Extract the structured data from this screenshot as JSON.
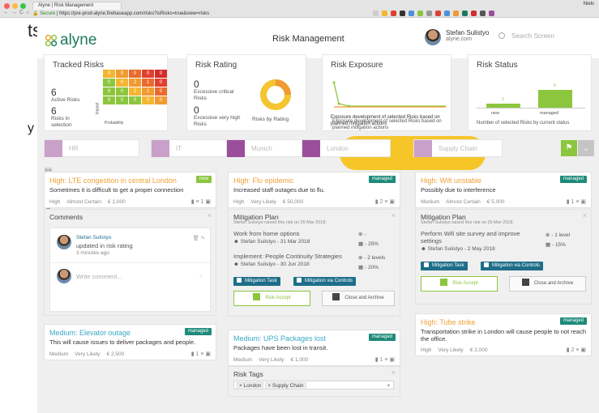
{
  "browser": {
    "tab_title": "Alyne | Risk Management",
    "secure_label": "Secure",
    "url": "https://pre-prod-alyne.firebaseapp.com/risks?isRisks=true&view=risks",
    "profile": "Niels"
  },
  "header": {
    "logo_text": "alyne",
    "page_title": "Risk Management",
    "user_name": "Stefan Sulistyo",
    "user_org": "alyne.com",
    "search_placeholder": "Search Screen"
  },
  "panels": {
    "tracked": {
      "title": "Tracked Risks",
      "active_count": "6",
      "active_label": "Active Risks",
      "selection_count": "6",
      "selection_label": "Risks in selection",
      "impact_label": "Impact",
      "probability_label": "Probability",
      "grid": [
        [
          "0",
          "0",
          "0",
          "0",
          "0"
        ],
        [
          "0",
          "0",
          "2",
          "1",
          "0"
        ],
        [
          "0",
          "0",
          "2",
          "1",
          "0"
        ],
        [
          "0",
          "0",
          "0",
          "0",
          "0"
        ]
      ],
      "grid_colors": [
        [
          "#f4b531",
          "#f09a31",
          "#ea6a2c",
          "#e0402e",
          "#d42b2b"
        ],
        [
          "#8cc63f",
          "#f4b531",
          "#f09a31",
          "#ea6a2c",
          "#e0402e"
        ],
        [
          "#8cc63f",
          "#8cc63f",
          "#f4b531",
          "#f09a31",
          "#ea6a2c"
        ],
        [
          "#8cc63f",
          "#8cc63f",
          "#8cc63f",
          "#f4b531",
          "#f09a31"
        ]
      ]
    },
    "rating": {
      "title": "Risk Rating",
      "excessive_critical_count": "0",
      "excessive_critical_label": "Excessive critical Risks",
      "excessive_high_count": "0",
      "excessive_high_label": "Excessive very high Risks",
      "by_rating_label": "Risks by Rating"
    },
    "exposure": {
      "title": "Risk Exposure",
      "caption": "Exposure development of selected Risks based on planned mitigation actions"
    },
    "status": {
      "title": "Risk Status",
      "bars": [
        {
          "label": "new",
          "value": 1
        },
        {
          "label": "managed",
          "value": 5
        }
      ],
      "caption": "Number of selected Risks by current status"
    }
  },
  "filters": [
    {
      "label": "HR",
      "color": "#c9a0c9"
    },
    {
      "label": "IT",
      "color": "#c9a0c9"
    },
    {
      "label": "Munich",
      "color": "#9b4f9b"
    },
    {
      "label": "London",
      "color": "#9b4f9b"
    },
    {
      "label": "Supply Chain",
      "color": "#c9a0c9"
    }
  ],
  "cards": {
    "lte": {
      "title": "High: LTE congestion in central London",
      "badge": "new",
      "desc": "Sometimes it is difficult to get a proper connection",
      "level": "High",
      "prob": "Almost Certain",
      "cost": "€ 1,000",
      "count": "1"
    },
    "flu": {
      "title": "High: Flu epidemic",
      "badge": "managed",
      "desc": "Increased staff outages due to flu.",
      "level": "High",
      "prob": "Very Likely",
      "cost": "€ 50,000",
      "count": "2"
    },
    "wifi": {
      "title": "High: Wifi unstable",
      "badge": "managed",
      "desc": "Possibly due to interference",
      "level": "Medium",
      "prob": "Almost Certain",
      "cost": "€ 5,000",
      "count": "1"
    },
    "elevator": {
      "title": "Medium: Elevator outage",
      "badge": "managed",
      "desc": "This will cause issues to deliver packages and people.",
      "level": "Medium",
      "prob": "Very Likely",
      "cost": "€ 2,500",
      "count": "1"
    },
    "ups": {
      "title": "Medium: UPS Packages lost",
      "badge": "managed",
      "desc": "Packages have been lost in transit.",
      "level": "Medium",
      "prob": "Very Likely",
      "cost": "€ 1,000",
      "count": "1"
    },
    "tube": {
      "title": "High: Tube strike",
      "badge": "managed",
      "desc": "Transportation strike in London will cause people to not reach the office.",
      "level": "High",
      "prob": "Very Likely",
      "cost": "€ 2,000",
      "count": "2"
    }
  },
  "comments": {
    "title": "Comments",
    "author": "Stefan Sulistyo",
    "text": "updated in risk rating",
    "time": "3 minutes ago",
    "placeholder": "Write comment..."
  },
  "mitigation_flu": {
    "title": "Mitigation Plan",
    "note": "Stefan Sulistyo raised this risk on 26 Mar 2018.",
    "items": [
      {
        "name": "Work from home options",
        "owner": "Stefan Sulistyo - 31 Mar 2018",
        "level": "-",
        "pct": "- 25%"
      },
      {
        "name": "Implement: People Continuity Strategies",
        "owner": "Stefan Sulistyo - 30 Jun 2018",
        "level": "- 2 levels",
        "pct": "- 20%"
      }
    ],
    "btn_task": "Mitigation Task",
    "btn_controls": "Mitigation via Controls",
    "accept": "Risk Accept",
    "archive": "Close and Archive"
  },
  "mitigation_wifi": {
    "title": "Mitigation Plan",
    "note": "Stefan Sulistyo raised this risk on 26 Mar 2018.",
    "item_name": "Perform Wifi site survey and improve settings",
    "owner": "Stefan Sulistyo - 2 May 2018",
    "level": "- 1 level",
    "pct": "- 15%",
    "btn_task": "Mitigation Task",
    "btn_controls": "Mitigation via Controls",
    "accept": "Risk Accept",
    "archive": "Close and Archive"
  },
  "tags": {
    "title": "Risk Tags",
    "items": [
      "London",
      "Supply Chain"
    ]
  },
  "leftpeek": {
    "t1": "ts",
    "t2": "y"
  },
  "colors": {
    "accent": "#1e7b5a",
    "orange": "#f0a035",
    "green": "#8cc63f",
    "badge_new": "#8cc63f",
    "badge_managed": "#1e8a7a",
    "highlight": "#f5c31e"
  }
}
